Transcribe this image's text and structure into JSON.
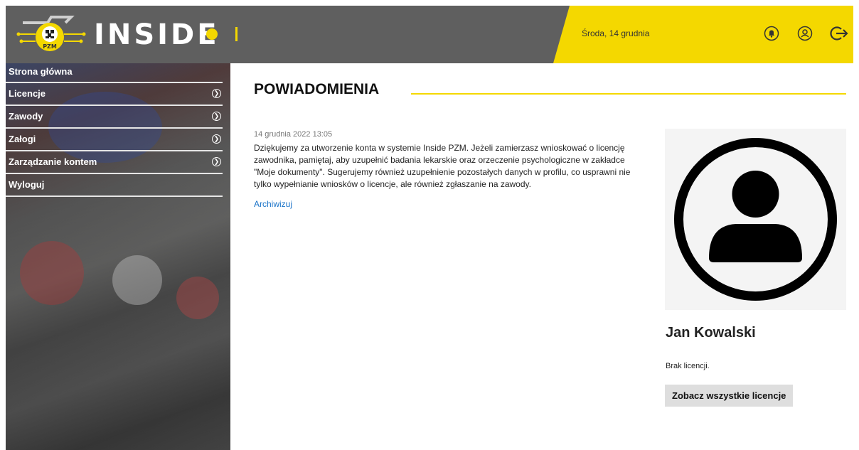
{
  "header": {
    "logo_text": "INSIDE",
    "logo_emblem_text": "PZM",
    "date": "Środa, 14 grudnia",
    "icons": [
      "bell-icon",
      "user-icon",
      "logout-icon"
    ]
  },
  "sidebar": {
    "items": [
      {
        "label": "Strona główna",
        "has_chevron": false
      },
      {
        "label": "Licencje",
        "has_chevron": true
      },
      {
        "label": "Zawody",
        "has_chevron": true
      },
      {
        "label": "Załogi",
        "has_chevron": true
      },
      {
        "label": "Zarządzanie kontem",
        "has_chevron": true
      },
      {
        "label": "Wyloguj",
        "has_chevron": false
      }
    ]
  },
  "main": {
    "title": "POWIADOMIENIA",
    "notification": {
      "date": "14 grudnia 2022 13:05",
      "text": "Dziękujemy za utworzenie konta w systemie Inside PZM. Jeżeli zamierzasz wnioskować o licencję zawodnika, pamiętaj, aby uzupełnić badania lekarskie oraz orzeczenie psychologiczne w zakładce \"Moje dokumenty\". Sugerujemy również uzupełnienie pozostałych danych w profilu, co usprawni nie tylko wypełnianie wniosków o licencje, ale również zgłaszanie na zawody.",
      "archive_label": "Archiwizuj"
    }
  },
  "profile": {
    "name": "Jan Kowalski",
    "license_status": "Brak licencji.",
    "all_licenses_button": "Zobacz wszystkie licencje"
  },
  "colors": {
    "accent_yellow": "#f4d800",
    "header_gray": "#5f5f5f",
    "link_blue": "#1a73c8"
  }
}
